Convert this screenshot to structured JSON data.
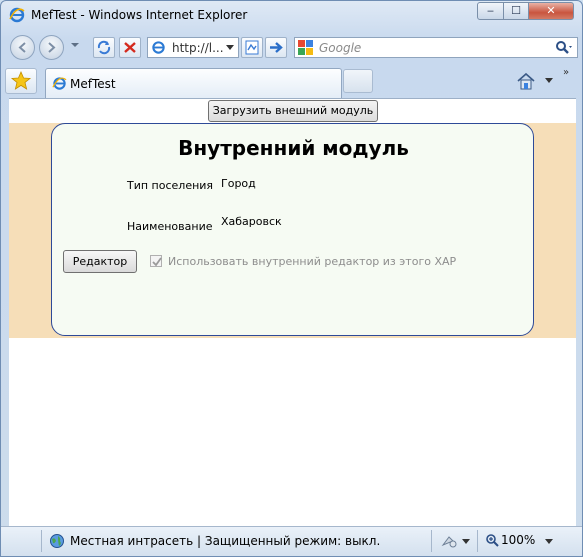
{
  "window": {
    "title": "MefTest - Windows Internet Explorer",
    "minimize_label": "‒",
    "maximize_label": "☐",
    "close_label": "✕"
  },
  "navbar": {
    "address": "http://l...",
    "search_placeholder": "Google"
  },
  "tabs": [
    {
      "label": "MefTest"
    }
  ],
  "page": {
    "load_button": "Загрузить внешний модуль",
    "module": {
      "title": "Внутренний модуль",
      "fields": [
        {
          "label": "Тип поселения",
          "value": "Город"
        },
        {
          "label": "Наименование",
          "value": "Хабаровск"
        }
      ],
      "edit_button": "Редактор",
      "checkbox_label": "Использовать внутренний редактор из этого XAP",
      "checkbox_checked": true
    }
  },
  "statusbar": {
    "zone_text": "Местная интрасеть | Защищенный режим: выкл.",
    "zoom": "100%"
  },
  "colors": {
    "band": "#f6deb8",
    "module_bg": "#f6fbf3",
    "module_border": "#2e4a98"
  }
}
